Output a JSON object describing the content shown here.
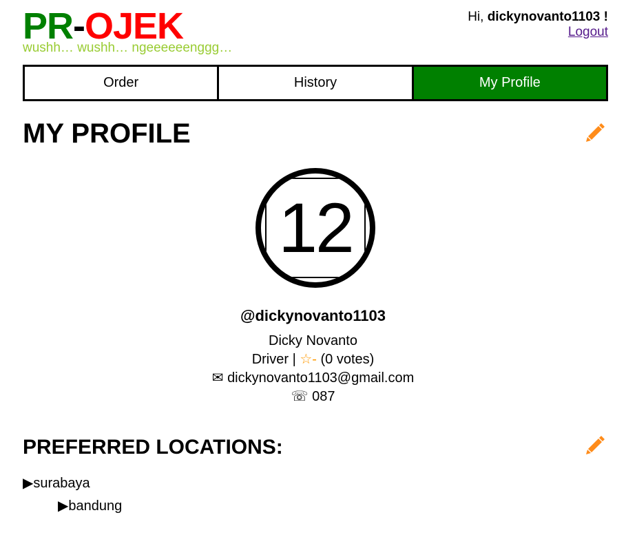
{
  "header": {
    "logo_pr": "PR",
    "logo_dash": "-",
    "logo_ojek": "OJEK",
    "tagline": "wushh… wushh… ngeeeeeenggg…",
    "greeting_prefix": "Hi, ",
    "username": "dickynovanto1103",
    "greeting_suffix": " !",
    "logout_label": "Logout"
  },
  "tabs": [
    {
      "label": "Order"
    },
    {
      "label": "History"
    },
    {
      "label": "My Profile",
      "active": true
    }
  ],
  "profile": {
    "title": "MY PROFILE",
    "avatar_text": "12",
    "handle": "@dickynovanto1103",
    "full_name": "Dicky Novanto",
    "role": "Driver",
    "role_separator": " | ",
    "rating": "☆-",
    "votes": " (0 votes)",
    "email_icon": "✉",
    "email": "dickynovanto1103@gmail.com",
    "phone_icon": "☏",
    "phone": "087"
  },
  "preferred_locations": {
    "title": "PREFERRED LOCATIONS:",
    "marker": "▶",
    "items": [
      "surabaya",
      "bandung"
    ]
  },
  "colors": {
    "brand_green": "#008000",
    "brand_red": "#ff0000",
    "tagline_green": "#99cc33",
    "edit_orange": "#ff8c1a",
    "star_orange": "#ff9900"
  },
  "icons": {
    "edit_profile": "pencil-icon",
    "edit_locations": "pencil-icon"
  }
}
